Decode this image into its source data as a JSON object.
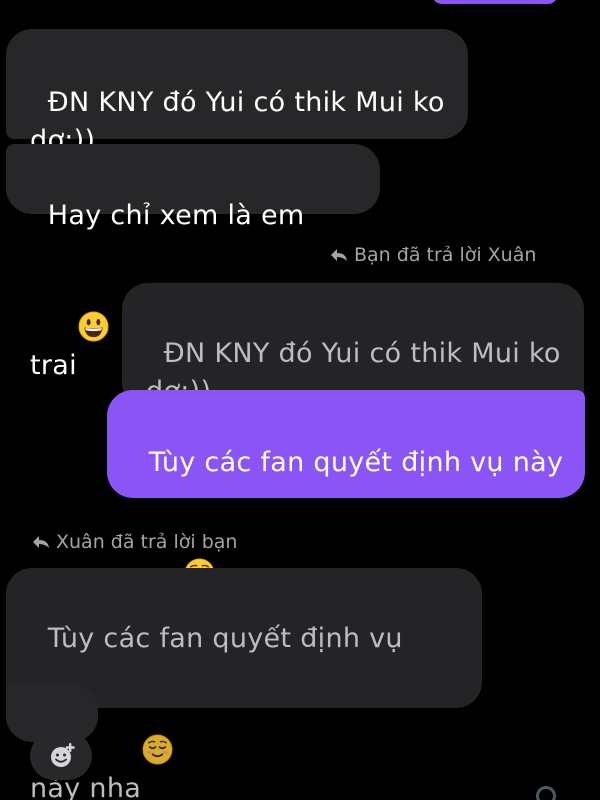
{
  "conversation": {
    "received_group_1": [
      "ĐN KNY đó Yui có thik Mui ko dợ:))",
      "Hay chỉ xem là em trai"
    ],
    "reply_label_you": "Bạn đã trả lời Xuân",
    "quoted_in_your_reply": "ĐN KNY đó Yui có thik Mui ko dợ:))",
    "your_reply": "Tùy các fan quyết định vụ này nha",
    "reply_label_xuan": "Xuân đã trả lời bạn",
    "quoted_in_xuan_reply": "Tùy các fan quyết định vụ này nha",
    "xuan_reply": ":)))"
  },
  "icons": {
    "grinning_emoji": "grinning-face-emoji",
    "relieved_emoji": "relieved-face-emoji",
    "reply_arrow": "reply-arrow-icon",
    "add_reaction": "add-reaction-icon"
  },
  "colors": {
    "background": "#000000",
    "incoming_bubble": "#27272a",
    "outgoing_bubble": "#8b55f5",
    "quoted_text": "#bdbdc0",
    "meta_text": "#a4a4a8"
  }
}
